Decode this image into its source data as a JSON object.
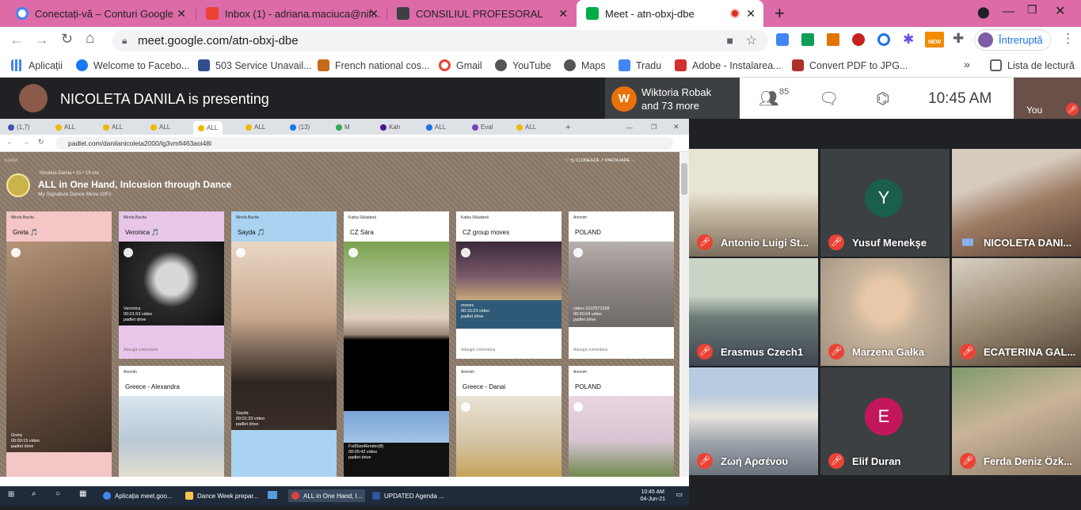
{
  "browser": {
    "tabs": [
      {
        "title": "Conectați-vă – Conturi Google",
        "icon": "google-icon"
      },
      {
        "title": "Inbox (1) - adriana.maciuca@nif...",
        "icon": "gmail-icon"
      },
      {
        "title": "CONSILIUL PROFESORAL",
        "icon": "classroom-icon"
      },
      {
        "title": "Meet - atn-obxj-dbe",
        "icon": "meet-icon"
      }
    ],
    "new_tab": "+",
    "url": "meet.google.com/atn-obxj-dbe",
    "profile_label": "Întreruptă",
    "bookmarks": [
      {
        "label": "Aplicații",
        "color": "#4285f4"
      },
      {
        "label": "Welcome to Facebo...",
        "color": "#1877f2"
      },
      {
        "label": "503 Service Unavail...",
        "color": "#2f4f8f"
      },
      {
        "label": "French national cos...",
        "color": "#c46a1a"
      },
      {
        "label": "Gmail",
        "color": "#ea4335"
      },
      {
        "label": "YouTube",
        "color": "#555555"
      },
      {
        "label": "Maps",
        "color": "#555555"
      },
      {
        "label": "Tradu",
        "color": "#4285f4"
      },
      {
        "label": "Adobe - Instalarea...",
        "color": "#d32f2f"
      },
      {
        "label": "Convert PDF to JPG...",
        "color": "#b0302a"
      }
    ],
    "more": "»",
    "reading_list": "Lista de lectură"
  },
  "meet": {
    "presenter_text": "NICOLETA DANILA is presenting",
    "raised_hand": {
      "initial": "W",
      "line1": "Wiktoria Robak",
      "line2": "and 73 more"
    },
    "participants_count": "85",
    "clock": "10:45 AM",
    "self_label": "You"
  },
  "shared_screen": {
    "tabs": [
      "(1,7)",
      "ALL",
      "ALL",
      "ALL",
      "ALL",
      "ALL",
      "(13)",
      "M",
      "Kah",
      "ALL",
      "Eval",
      "ALL"
    ],
    "url": "padlet.com/danilanicoleta2000/lg3vmfi463aoi48i",
    "padlet": {
      "brand": "padlet",
      "author": "Nicoleta Danila  •  15  •  19 ore",
      "title": "ALL in One Hand, Inlcusion through Dance",
      "subtitle": "My Signature Dance Move GIFs",
      "actions": "♡   ⇆ CLONEAZĂ   ↗ PARTAJARE   ···",
      "fab": "+"
    },
    "columns": [
      {
        "author": "Mirela Bacita",
        "title": "Greta 🎵",
        "caption1": "Greta",
        "caption2": "00:00:15 video",
        "caption3": "padlet drive",
        "bg": "#f4c6c6"
      },
      {
        "author": "Mirela Bacita",
        "title": "Veronica 🎵",
        "caption1": "Veronica",
        "caption2": "00:01:53 video",
        "caption3": "padlet drive",
        "bg": "#e7c6ea",
        "comment": "Adaugă comentariu",
        "card2_author": "Anonim",
        "card2_title": "Greece - Alexandra"
      },
      {
        "author": "Mirela Bacita",
        "title": "Sayda 🎵",
        "caption1": "Sayda",
        "caption2": "00:01:33 video",
        "caption3": "padlet drive",
        "bg": "#a9d3f0"
      },
      {
        "author": "Katka Skladanà",
        "title": "CZ  Sára",
        "caption1": "FullSizeRender(8)",
        "caption2": "00:05:42 video",
        "caption3": "padlet drive",
        "bg": "#ffffff"
      },
      {
        "author": "Katka Skladanà",
        "title": "CZ group moves",
        "caption1": "moves",
        "caption2": "00:15:23 video",
        "caption3": "padlet drive",
        "bg": "#ffffff",
        "comment": "Adaugă comentariu",
        "card2_author": "Anonim",
        "card2_title": "Greece - Danai"
      },
      {
        "author": "Anonim",
        "title": "POLAND",
        "caption1": "video-1622571358",
        "caption2": "00:20:04 video",
        "caption3": "padlet drive",
        "bg": "#ffffff",
        "comment": "Adaugă comentariu",
        "card2_author": "Anonim",
        "card2_title": "POLAND"
      }
    ],
    "taskbar": {
      "items": [
        "Aplicația meet.goo...",
        "Dance Week prepar...",
        "ALL in One Hand, I...",
        "UPDATED Agenda ..."
      ],
      "time": "10:45 AM",
      "date": "04-Jun-21"
    }
  },
  "participants": [
    {
      "name": "Antonio Luigi St...",
      "muted": true,
      "kind": "video",
      "tone": "#c9c2a8"
    },
    {
      "name": "Yusuf Menekşe",
      "muted": true,
      "kind": "avatar",
      "initial": "Y",
      "color": "#1a5e4c"
    },
    {
      "name": "NICOLETA DANI...",
      "muted": false,
      "kind": "video",
      "tone": "#9c7b63"
    },
    {
      "name": "Erasmus Czech1",
      "muted": true,
      "kind": "video",
      "tone": "#8b8f86"
    },
    {
      "name": "Marzena Gałka",
      "muted": true,
      "kind": "video",
      "tone": "#b0a28d"
    },
    {
      "name": "ECATERINA GAL...",
      "muted": true,
      "kind": "video",
      "tone": "#7d6a55"
    },
    {
      "name": "Ζωή Αρσένου",
      "muted": true,
      "kind": "video",
      "tone": "#a7b0bc"
    },
    {
      "name": "Elif Duran",
      "muted": true,
      "kind": "avatar",
      "initial": "E",
      "color": "#c2185b"
    },
    {
      "name": "Ferda Deniz Özk...",
      "muted": true,
      "kind": "video",
      "tone": "#8fa08a"
    }
  ]
}
